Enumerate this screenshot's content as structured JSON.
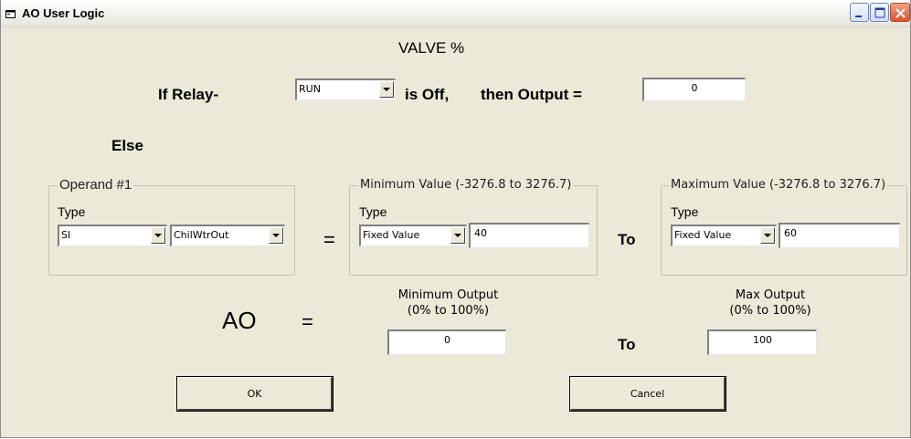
{
  "window": {
    "title": "AO User Logic",
    "icon": "app-window-icon",
    "minimize": "minimize-icon",
    "maximize": "maximize-icon",
    "close": "close-icon"
  },
  "header": {
    "heading": "VALVE %"
  },
  "relay": {
    "prefix": "If Relay-",
    "selected": "RUN",
    "middle": "is Off,",
    "then_label": "then Output =",
    "output_value": "0"
  },
  "else_label": "Else",
  "operand": {
    "legend": "Operand #1",
    "type_label": "Type",
    "type_selected": "SI",
    "point_selected": "ChilWtrOut"
  },
  "equals": "=",
  "min_value": {
    "legend": "Minimum Value (-3276.8 to 3276.7)",
    "type_label": "Type",
    "type_selected": "Fixed Value",
    "value": "40"
  },
  "to_label": "To",
  "max_value": {
    "legend": "Maximum Value (-3276.8 to 3276.7)",
    "type_label": "Type",
    "type_selected": "Fixed Value",
    "value": "60"
  },
  "ao_row": {
    "ao_label": "AO",
    "equals": "=",
    "min_output_label_1": "Minimum Output",
    "min_output_label_2": "(0% to 100%)",
    "min_output_value": "0",
    "to_label": "To",
    "max_output_label_1": "Max Output",
    "max_output_label_2": "(0% to 100%)",
    "max_output_value": "100"
  },
  "buttons": {
    "ok": "OK",
    "cancel": "Cancel"
  }
}
